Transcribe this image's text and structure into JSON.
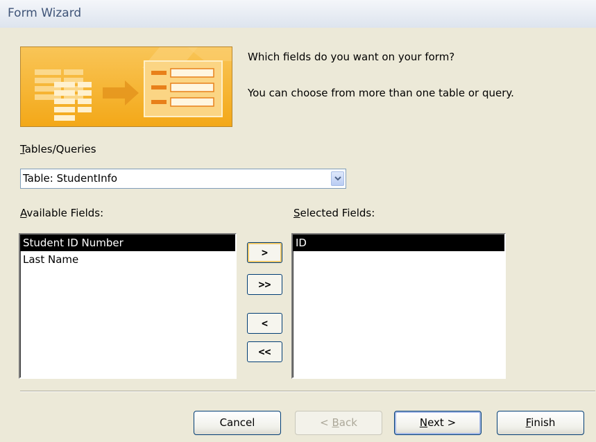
{
  "window": {
    "title": "Form Wizard"
  },
  "prompt": {
    "question": "Which fields do you want on your form?",
    "hint": "You can choose from more than one table or query."
  },
  "tables_queries": {
    "label_accel": "T",
    "label_rest": "ables/Queries",
    "selected": "Table: StudentInfo"
  },
  "available_fields": {
    "label_accel": "A",
    "label_rest": "vailable Fields:",
    "items": [
      "Student ID Number",
      "Last Name"
    ],
    "selected_index": 0
  },
  "selected_fields": {
    "label_accel": "S",
    "label_rest": "elected Fields:",
    "items": [
      "ID"
    ],
    "selected_index": 0
  },
  "move_buttons": {
    "add_one": ">",
    "add_all": ">>",
    "remove_one": "<",
    "remove_all": "<<"
  },
  "buttons": {
    "cancel": "Cancel",
    "back_pre": "< ",
    "back_accel": "B",
    "back_rest": "ack",
    "next_accel": "N",
    "next_rest": "ext >",
    "finish_accel": "F",
    "finish_rest": "inish"
  },
  "colors": {
    "graphic_orange": "#f7b835",
    "selection": "#000000",
    "title_text": "#3f5478"
  }
}
